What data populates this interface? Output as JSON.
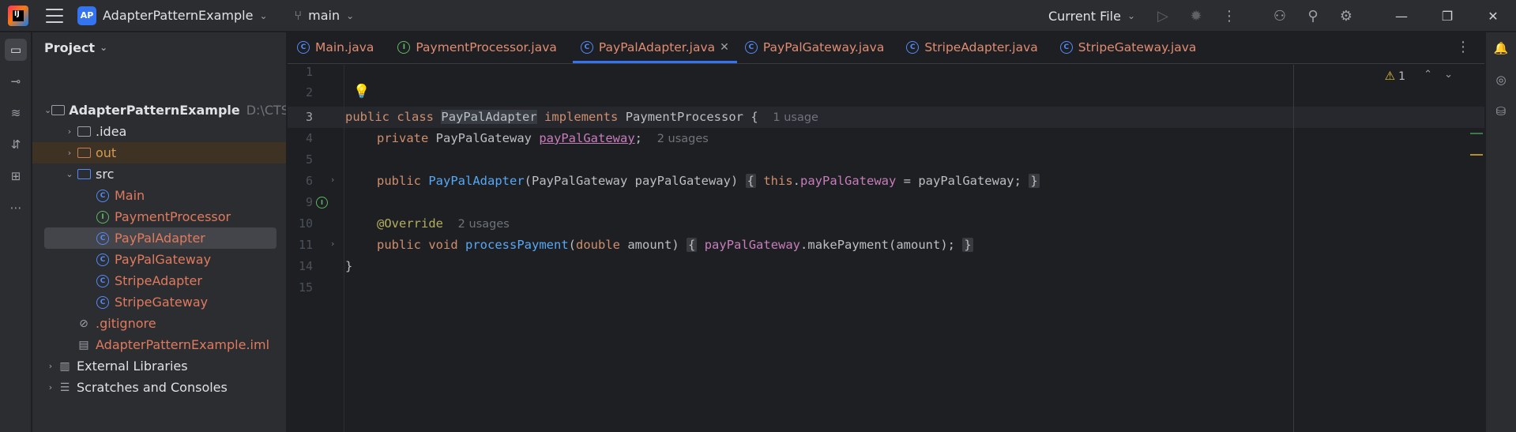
{
  "titlebar": {
    "logo_text": "IJ",
    "project_badge": "AP",
    "project_name": "AdapterPatternExample",
    "branch": "main",
    "run_config": "Current File"
  },
  "project_panel": {
    "title": "Project",
    "root_name": "AdapterPatternExample",
    "root_path": "D:\\CTS",
    "items": [
      {
        "label": ".idea"
      },
      {
        "label": "out"
      },
      {
        "label": "src"
      },
      {
        "label": "Main"
      },
      {
        "label": "PaymentProcessor"
      },
      {
        "label": "PayPalAdapter"
      },
      {
        "label": "PayPalGateway"
      },
      {
        "label": "StripeAdapter"
      },
      {
        "label": "StripeGateway"
      },
      {
        "label": ".gitignore"
      },
      {
        "label": "AdapterPatternExample.iml"
      },
      {
        "label": "External Libraries"
      },
      {
        "label": "Scratches and Consoles"
      }
    ]
  },
  "tabs": [
    {
      "label": "Main.java"
    },
    {
      "label": "PaymentProcessor.java"
    },
    {
      "label": "PayPalAdapter.java"
    },
    {
      "label": "PayPalGateway.java"
    },
    {
      "label": "StripeAdapter.java"
    },
    {
      "label": "StripeGateway.java"
    }
  ],
  "editor": {
    "line_numbers": [
      "1",
      "2",
      "3",
      "4",
      "5",
      "6",
      "9",
      "10",
      "11",
      "14",
      "15"
    ],
    "warning_count": "1",
    "line3": {
      "kw1": "public",
      "kw2": "class",
      "name": "PayPalAdapter",
      "kw3": "implements",
      "iface": "PaymentProcessor",
      "brace": "{",
      "hint": "1 usage"
    },
    "line4": {
      "kw": "private",
      "type": "PayPalGateway",
      "field": "payPalGateway",
      "semi": ";",
      "hint": "2 usages"
    },
    "line6": {
      "kw": "public",
      "ctor": "PayPalAdapter",
      "params": "(PayPalGateway payPalGateway)",
      "open": "{",
      "this": "this",
      "dot": ".",
      "field": "payPalGateway",
      "rest": " = payPalGateway;",
      "close": "}"
    },
    "line10": {
      "ann": "@Override",
      "hint": "2 usages"
    },
    "line11": {
      "kw1": "public",
      "kw2": "void",
      "method": "processPayment",
      "p_open": "(",
      "ptype": "double",
      "pname": " amount)",
      "open": "{",
      "field": "payPalGateway",
      "call": ".makePayment(amount);",
      "close": "}"
    },
    "line14": "}"
  },
  "colors": {
    "accent": "#3574f0",
    "keyword": "#cf8e6d",
    "function": "#56a8f5",
    "field": "#c77dbb",
    "annotation": "#b3ae60",
    "modified_file": "#e07a5f"
  }
}
